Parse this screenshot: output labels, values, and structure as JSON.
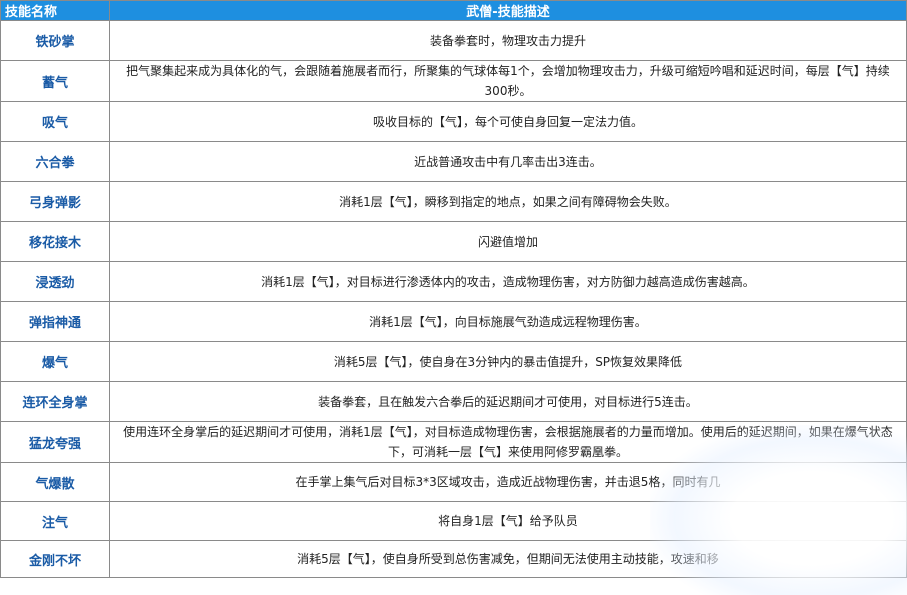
{
  "header": {
    "name_col": "技能名称",
    "desc_col": "武僧-技能描述"
  },
  "rows": [
    {
      "name": "铁砂掌",
      "desc": "装备拳套时，物理攻击力提升"
    },
    {
      "name": "蓄气",
      "desc": "把气聚集起来成为具体化的气，会跟随着施展者而行，所聚集的气球体每1个，会增加物理攻击力，升级可缩短吟唱和延迟时间，每层【气】持续300秒。"
    },
    {
      "name": "吸气",
      "desc": "吸收目标的【气】，每个可使自身回复一定法力值。"
    },
    {
      "name": "六合拳",
      "desc": "近战普通攻击中有几率击出3连击。"
    },
    {
      "name": "弓身弹影",
      "desc": "消耗1层【气】，瞬移到指定的地点，如果之间有障碍物会失败。"
    },
    {
      "name": "移花接木",
      "desc": "闪避值增加"
    },
    {
      "name": "浸透劲",
      "desc": "消耗1层【气】，对目标进行渗透体内的攻击，造成物理伤害，对方防御力越高造成伤害越高。"
    },
    {
      "name": "弹指神通",
      "desc": "消耗1层【气】，向目标施展气劲造成远程物理伤害。"
    },
    {
      "name": "爆气",
      "desc": "消耗5层【气】，使自身在3分钟内的暴击值提升，SP恢复效果降低"
    },
    {
      "name": "连环全身掌",
      "desc": "装备拳套，且在触发六合拳后的延迟期间才可使用，对目标进行5连击。"
    },
    {
      "name": "猛龙夸强",
      "desc": "使用连环全身掌后的延迟期间才可使用，消耗1层【气】，对目标造成物理伤害，会根据施展者的力量而增加。使用后的延迟期间，如果在爆气状态下，可消耗一层【气】来使用阿修罗霸凰拳。"
    },
    {
      "name": "气爆散",
      "desc": "在手掌上集气后对目标3*3区域攻击，造成近战物理伤害，并击退5格，同时有几"
    },
    {
      "name": "注气",
      "desc": "将自身1层【气】给予队员"
    },
    {
      "name": "金刚不坏",
      "desc": "消耗5层【气】，使自身所受到总伤害减免，但期间无法使用主动技能，攻速和移"
    }
  ],
  "colors": {
    "header_bg": "#1e8fe0",
    "name_text": "#1a5ba6",
    "border": "#8a8a8a"
  }
}
